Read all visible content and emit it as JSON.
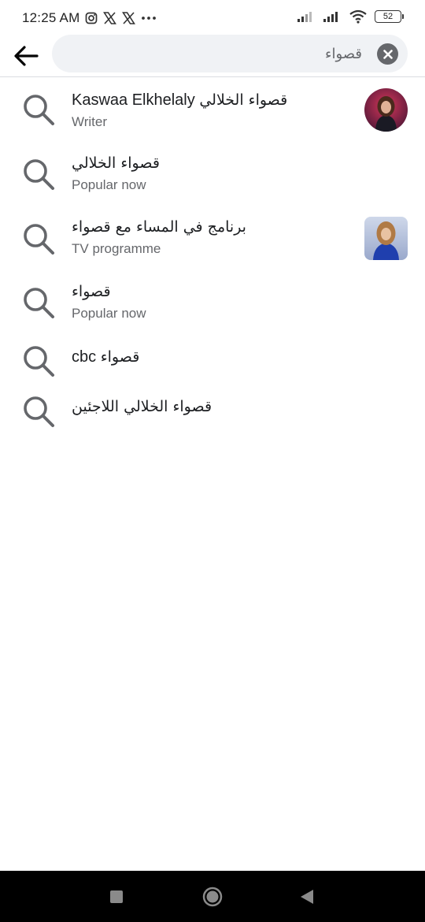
{
  "status_bar": {
    "time": "12:25 AM",
    "icons": [
      "instagram-icon",
      "x-icon",
      "x-icon",
      "more-dots-icon"
    ],
    "battery": "52"
  },
  "search": {
    "query": "قصواء"
  },
  "results": [
    {
      "title_latin": "Kaswaa Elkhelaly",
      "title_arabic": "قصواء الخلالي",
      "subtitle": "Writer",
      "thumbnail": "profile-photo",
      "thumbnail_shape": "circle"
    },
    {
      "title_latin": "",
      "title_arabic": "قصواء الخلالي",
      "subtitle": "Popular now",
      "thumbnail": null
    },
    {
      "title_latin": "",
      "title_arabic": "برنامج في المساء مع قصواء",
      "subtitle": "TV programme",
      "thumbnail": "programme-photo",
      "thumbnail_shape": "rounded"
    },
    {
      "title_latin": "",
      "title_arabic": "قصواء",
      "subtitle": "Popular now",
      "thumbnail": null
    },
    {
      "title_latin": "cbc",
      "title_arabic": "قصواء",
      "subtitle": "",
      "thumbnail": null
    },
    {
      "title_latin": "",
      "title_arabic": "قصواء الخلالي اللاجئين",
      "subtitle": "",
      "thumbnail": null
    }
  ],
  "colors": {
    "text_primary": "#1c1e21",
    "text_secondary": "#65676b",
    "search_bg": "#f0f2f5",
    "nav_bar": "#000000"
  }
}
